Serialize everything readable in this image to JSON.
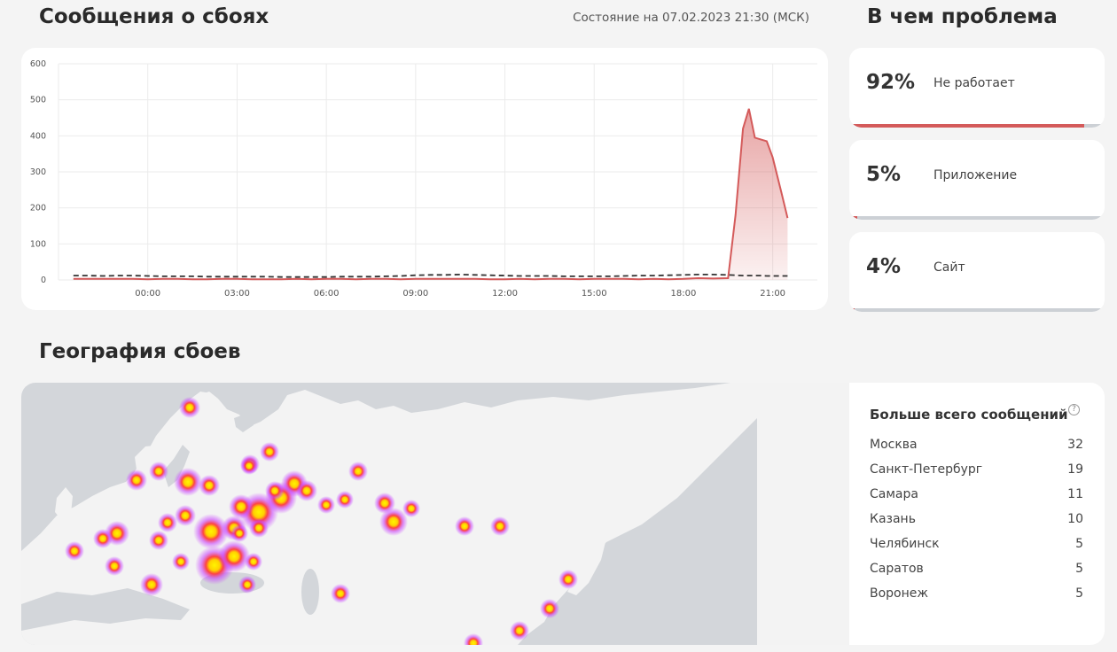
{
  "header": {
    "title": "Сообщения о сбоях",
    "status": "Состояние на 07.02.2023 21:30 (МСК)"
  },
  "problems": {
    "title": "В чем проблема",
    "items": [
      {
        "percent": "92%",
        "label": "Не работает",
        "fill": 0.92
      },
      {
        "percent": "5%",
        "label": "Приложение",
        "fill": 0.03
      },
      {
        "percent": "4%",
        "label": "Сайт",
        "fill": 0.02
      }
    ]
  },
  "geo": {
    "title": "География сбоев"
  },
  "top_cities": {
    "title": "Больше всего сообщений",
    "help_icon": "question-circle-icon",
    "rows": [
      {
        "city": "Москва",
        "count": "32"
      },
      {
        "city": "Санкт-Петербург",
        "count": "19"
      },
      {
        "city": "Самара",
        "count": "11"
      },
      {
        "city": "Казань",
        "count": "10"
      },
      {
        "city": "Челябинск",
        "count": "5"
      },
      {
        "city": "Саратов",
        "count": "5"
      },
      {
        "city": "Воронеж",
        "count": "5"
      }
    ]
  },
  "colors": {
    "reports_line": "#d45a5a",
    "baseline_line": "#333333",
    "heat_core": "#ffee00",
    "heat_mid": "#ff3a3a",
    "heat_outer": "#c83cff"
  },
  "chart_data": {
    "type": "area",
    "ylim": [
      0,
      600
    ],
    "yticks": [
      0,
      100,
      200,
      300,
      400,
      500,
      600
    ],
    "xticks": [
      "00:00",
      "03:00",
      "06:00",
      "09:00",
      "12:00",
      "15:00",
      "18:00",
      "21:00"
    ],
    "x_hours": [
      -2.5,
      -2,
      -1.5,
      -1,
      -0.5,
      0,
      0.5,
      1,
      1.5,
      2,
      2.5,
      3,
      3.5,
      4,
      4.5,
      5,
      5.5,
      6,
      6.5,
      7,
      7.5,
      8,
      8.5,
      9,
      9.5,
      10,
      10.5,
      11,
      11.5,
      12,
      12.5,
      13,
      13.5,
      14,
      14.5,
      15,
      15.5,
      16,
      16.5,
      17,
      17.5,
      18,
      18.5,
      19,
      19.5,
      19.75,
      20,
      20.2,
      20.4,
      20.6,
      20.8,
      21,
      21.3,
      21.5
    ],
    "series": [
      {
        "values": [
          3,
          3,
          3,
          3,
          3,
          2,
          3,
          3,
          2,
          2,
          3,
          3,
          2,
          2,
          2,
          3,
          2,
          3,
          3,
          2,
          3,
          3,
          2,
          3,
          3,
          3,
          3,
          3,
          2,
          2,
          3,
          2,
          3,
          3,
          2,
          3,
          3,
          3,
          2,
          3,
          2,
          3,
          5,
          4,
          5,
          180,
          420,
          475,
          395,
          390,
          385,
          340,
          240,
          172
        ]
      },
      {
        "values": [
          12,
          12,
          11,
          12,
          12,
          11,
          10,
          10,
          10,
          9,
          9,
          9,
          9,
          9,
          8,
          8,
          8,
          8,
          9,
          9,
          9,
          10,
          11,
          13,
          14,
          14,
          15,
          14,
          13,
          12,
          11,
          11,
          11,
          10,
          10,
          10,
          10,
          11,
          12,
          12,
          13,
          14,
          15,
          15,
          14,
          13,
          12,
          12,
          12,
          12,
          11,
          11,
          11,
          11
        ]
      }
    ]
  }
}
